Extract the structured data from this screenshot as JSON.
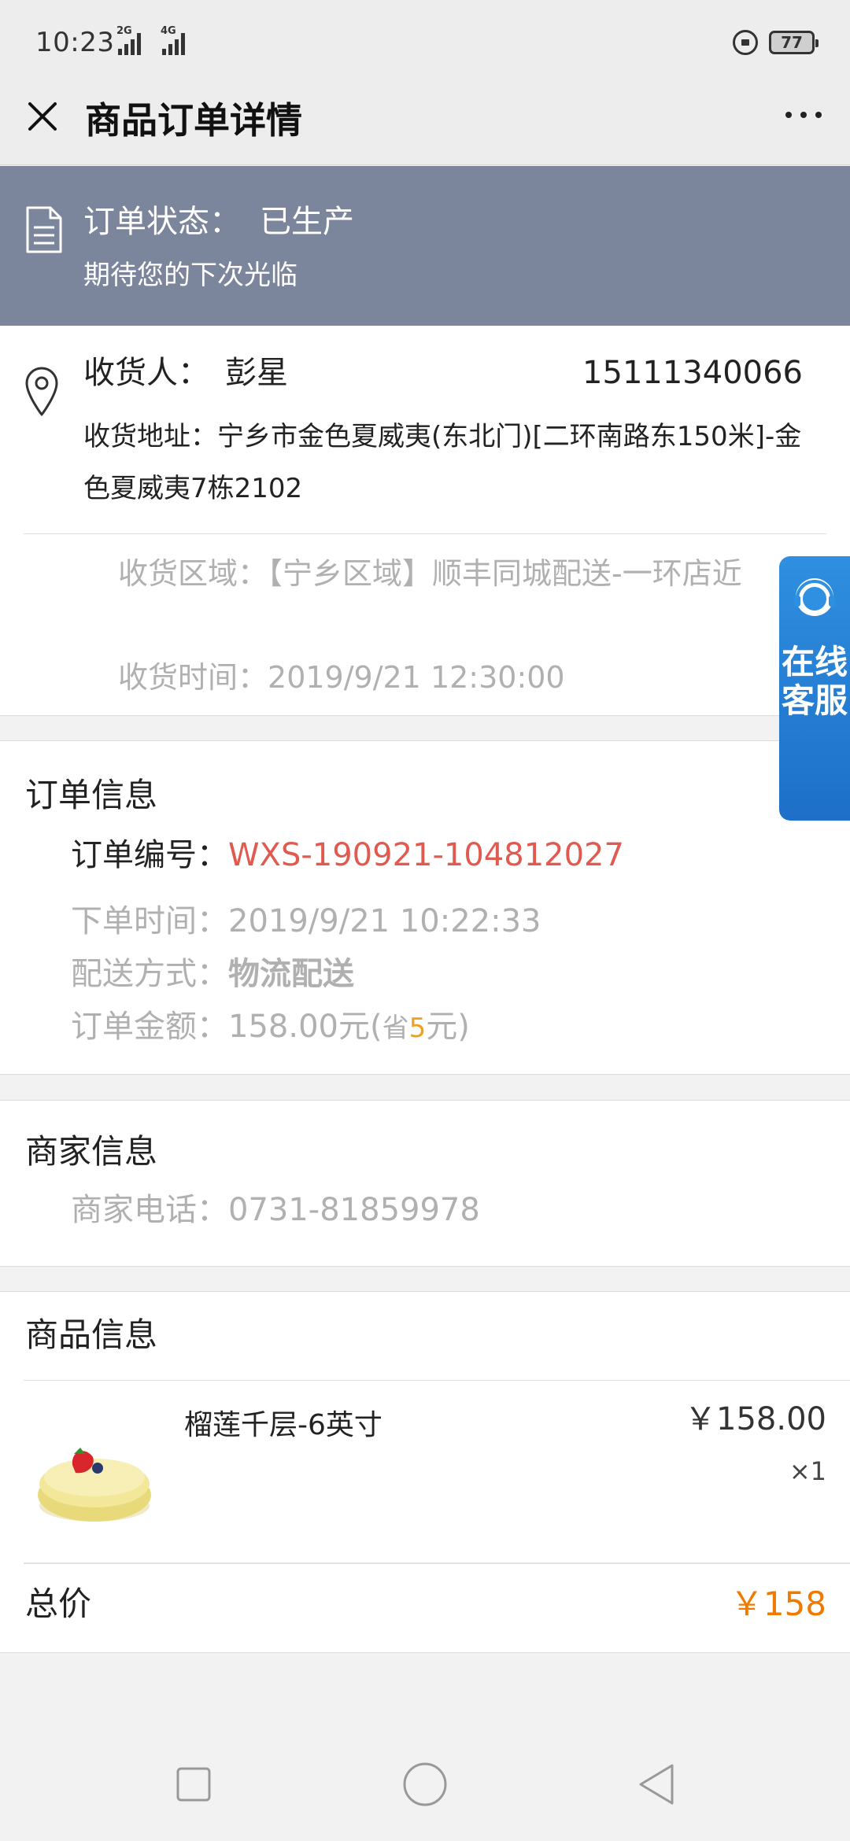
{
  "status_bar": {
    "time": "10:23",
    "signal1_label": "2G",
    "signal2_label": "4G",
    "battery": "77"
  },
  "header": {
    "title": "商品订单详情"
  },
  "order_status": {
    "label": "订单状态：",
    "value": "已生产",
    "subtitle": "期待您的下次光临"
  },
  "address": {
    "receiver_label": "收货人：",
    "receiver_name": "彭星",
    "phone": "15111340066",
    "address_label": "收货地址：",
    "address_value": "宁乡市金色夏威夷(东北门)[二环南路东150米]-金色夏威夷7栋2102",
    "area_label": "收货区域：",
    "area_value": "【宁乡区域】顺丰同城配送-一环店近",
    "time_label": "收货时间：",
    "time_value": "2019/9/21 12:30:00"
  },
  "order_info": {
    "title": "订单信息",
    "no_label": "订单编号：",
    "no_value": "WXS-190921-104812027",
    "placed_label": "下单时间：",
    "placed_value": "2019/9/21 10:22:33",
    "delivery_label": "配送方式：",
    "delivery_value": "物流配送",
    "amount_label": "订单金额：",
    "amount_value": "158.00元",
    "save_open": "(",
    "save_label": "省",
    "save_value": "5",
    "save_unit": "元)"
  },
  "merchant": {
    "title": "商家信息",
    "phone_label": "商家电话：",
    "phone_value": "0731-81859978"
  },
  "goods": {
    "title": "商品信息",
    "items": [
      {
        "name": "榴莲千层-6英寸",
        "price": "￥158.00",
        "qty": "×1"
      }
    ],
    "total_label": "总价",
    "total_value": "￥158"
  },
  "customer_service": {
    "label": "在线客服"
  },
  "colors": {
    "banner": "#7b859b",
    "order_no": "#e05a4f",
    "total": "#f07a00",
    "save_highlight": "#f0a020",
    "cs_button": "#1d6fc8"
  }
}
